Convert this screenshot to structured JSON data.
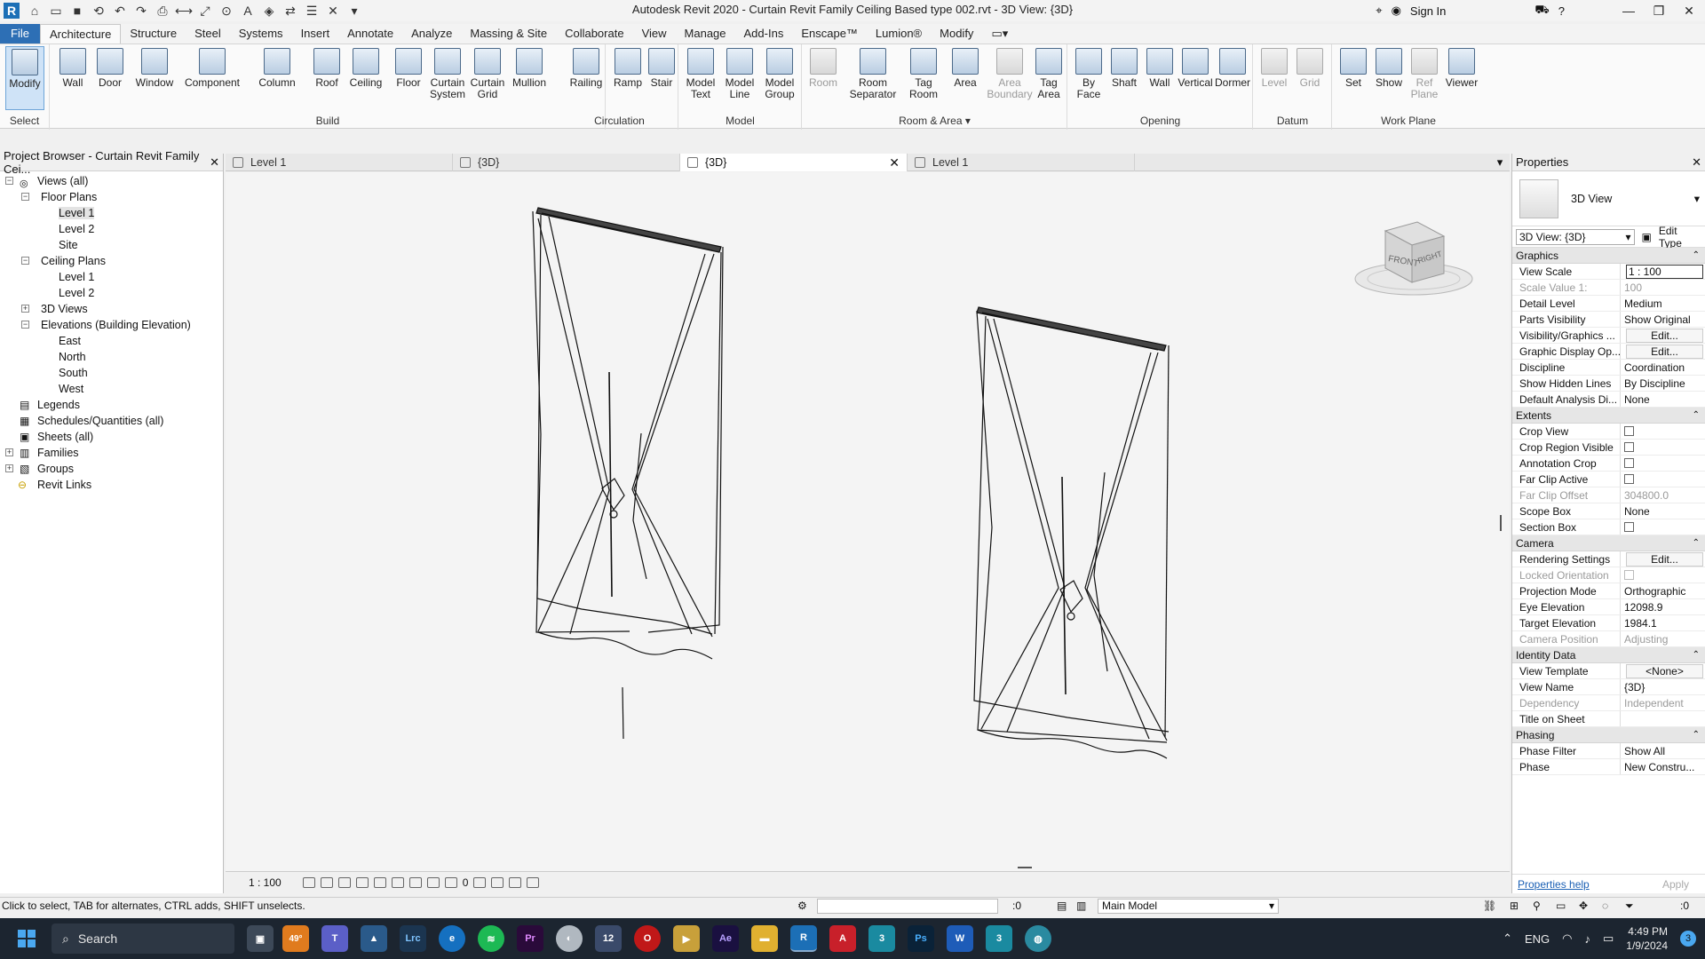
{
  "titlebar": {
    "title": "Autodesk Revit 2020 - Curtain Revit Family Ceiling Based type 002.rvt - 3D View: {3D}",
    "sign_in": "Sign In"
  },
  "ribbon": {
    "tabs": [
      "File",
      "Architecture",
      "Structure",
      "Steel",
      "Systems",
      "Insert",
      "Annotate",
      "Analyze",
      "Massing & Site",
      "Collaborate",
      "View",
      "Manage",
      "Add-Ins",
      "Enscape™",
      "Lumion®",
      "Modify"
    ],
    "groups": {
      "select": "Select",
      "build": "Build",
      "circulation": "Circulation",
      "model": "Model",
      "room_area": "Room & Area",
      "opening": "Opening",
      "datum": "Datum",
      "work_plane": "Work Plane"
    },
    "buttons": {
      "modify": "Modify",
      "wall": "Wall",
      "door": "Door",
      "window": "Window",
      "component": "Component",
      "column": "Column",
      "roof": "Roof",
      "ceiling": "Ceiling",
      "floor": "Floor",
      "curtain_system": "Curtain System",
      "curtain_grid": "Curtain Grid",
      "mullion": "Mullion",
      "railing": "Railing",
      "ramp": "Ramp",
      "stair": "Stair",
      "model_text": "Model Text",
      "model_line": "Model Line",
      "model_group": "Model Group",
      "room": "Room",
      "room_separator": "Room Separator",
      "tag_room": "Tag Room",
      "area": "Area",
      "area_boundary": "Area Boundary",
      "tag_area": "Tag Area",
      "by_face": "By Face",
      "shaft": "Shaft",
      "opening_wall": "Wall",
      "vertical": "Vertical",
      "dormer": "Dormer",
      "level": "Level",
      "grid": "Grid",
      "set": "Set",
      "show": "Show",
      "ref_plane": "Ref Plane",
      "viewer": "Viewer"
    }
  },
  "browser": {
    "title": "Project Browser - Curtain Revit Family Cei...",
    "tree": {
      "views_all": "Views (all)",
      "floor_plans": "Floor Plans",
      "fp_level1": "Level 1",
      "fp_level2": "Level 2",
      "fp_site": "Site",
      "ceiling_plans": "Ceiling Plans",
      "cp_level1": "Level 1",
      "cp_level2": "Level 2",
      "views_3d": "3D Views",
      "elevations": "Elevations (Building Elevation)",
      "el_east": "East",
      "el_north": "North",
      "el_south": "South",
      "el_west": "West",
      "legends": "Legends",
      "schedules": "Schedules/Quantities (all)",
      "sheets": "Sheets (all)",
      "families": "Families",
      "groups": "Groups",
      "revit_links": "Revit Links"
    }
  },
  "view_tabs": [
    "Level 1",
    "{3D}",
    "{3D}",
    "Level 1"
  ],
  "view_controls": {
    "scale": "1 : 100",
    "hidden": "0"
  },
  "viewcube": {
    "front": "FRONT",
    "right": "RIGHT"
  },
  "properties": {
    "title": "Properties",
    "type_name": "3D View",
    "view_selector": "3D View: {3D}",
    "edit_type": "Edit Type",
    "sections": {
      "graphics": "Graphics",
      "extents": "Extents",
      "camera": "Camera",
      "identity": "Identity Data",
      "phasing": "Phasing"
    },
    "graphics": {
      "view_scale": [
        "View Scale",
        "1 : 100"
      ],
      "scale_value": [
        "Scale Value    1:",
        "100"
      ],
      "detail_level": [
        "Detail Level",
        "Medium"
      ],
      "parts_visibility": [
        "Parts Visibility",
        "Show Original"
      ],
      "vis_graphics": [
        "Visibility/Graphics ...",
        "Edit..."
      ],
      "graphic_display": [
        "Graphic Display Op...",
        "Edit..."
      ],
      "discipline": [
        "Discipline",
        "Coordination"
      ],
      "hidden_lines": [
        "Show Hidden Lines",
        "By Discipline"
      ],
      "default_analysis": [
        "Default Analysis Di...",
        "None"
      ]
    },
    "extents": {
      "crop_view": "Crop View",
      "crop_region": "Crop Region Visible",
      "annotation_crop": "Annotation Crop",
      "far_clip_active": "Far Clip Active",
      "far_clip_offset": [
        "Far Clip Offset",
        "304800.0"
      ],
      "scope_box": [
        "Scope Box",
        "None"
      ],
      "section_box": "Section Box"
    },
    "camera": {
      "rendering": [
        "Rendering Settings",
        "Edit..."
      ],
      "locked": "Locked Orientation",
      "projection": [
        "Projection Mode",
        "Orthographic"
      ],
      "eye": [
        "Eye Elevation",
        "12098.9"
      ],
      "target": [
        "Target Elevation",
        "1984.1"
      ],
      "camera_pos": [
        "Camera Position",
        "Adjusting"
      ]
    },
    "identity": {
      "template": [
        "View Template",
        "<None>"
      ],
      "view_name": [
        "View Name",
        "{3D}"
      ],
      "dependency": [
        "Dependency",
        "Independent"
      ],
      "title_sheet": [
        "Title on Sheet",
        ""
      ]
    },
    "phasing": {
      "filter": [
        "Phase Filter",
        "Show All"
      ],
      "phase": [
        "Phase",
        "New Constru..."
      ]
    },
    "help": "Properties help",
    "apply": "Apply"
  },
  "statusbar": {
    "text": "Click to select, TAB for alternates, CTRL adds, SHIFT unselects.",
    "zero": ":0",
    "model": "Main Model",
    "filter": ":0"
  },
  "taskbar": {
    "search": "Search",
    "weather": "49°",
    "lang": "ENG",
    "time": "4:49 PM",
    "date": "1/9/2024",
    "badge": "3"
  }
}
